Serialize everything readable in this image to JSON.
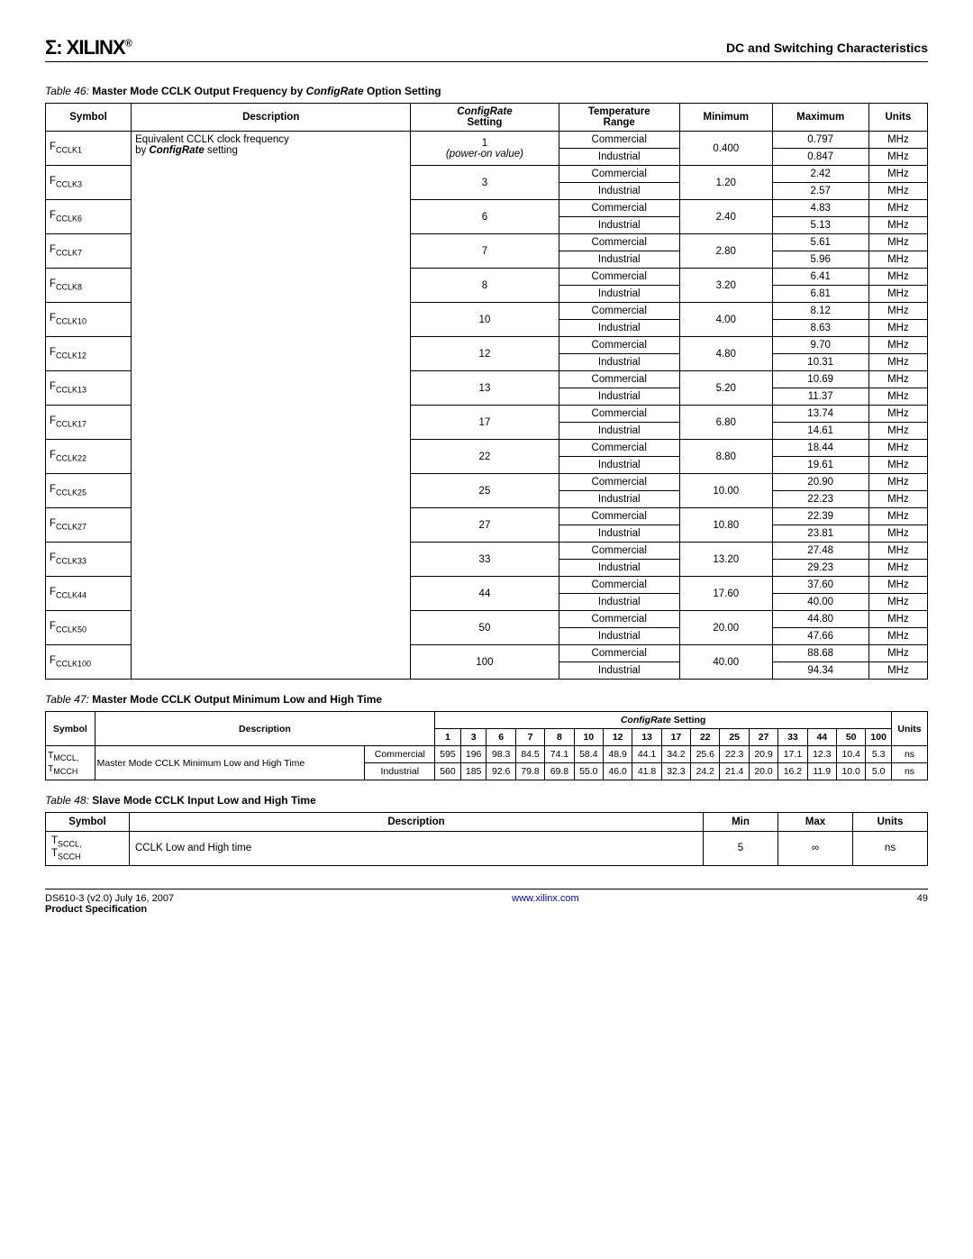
{
  "header": {
    "logo_text": "XILINX",
    "logo_mark": "Σ:",
    "doc_title": "DC and Switching Characteristics"
  },
  "table46": {
    "title_prefix": "Table  46:",
    "title_bold1": "Master Mode CCLK Output Frequency by ",
    "title_ital": "ConfigRate",
    "title_bold2": " Option Setting",
    "headers": {
      "symbol": "Symbol",
      "description": "Description",
      "config_ital": "ConfigRate",
      "config_setting": "Setting",
      "temp": "Temperature",
      "range": "Range",
      "min": "Minimum",
      "max": "Maximum",
      "units": "Units"
    },
    "desc_line1": "Equivalent CCLK clock frequency",
    "desc_line2_pre": "by ",
    "desc_line2_ital": "ConfigRate",
    "desc_line2_post": " setting",
    "power_on": "(power-on value)",
    "temp_comm": "Commercial",
    "temp_ind": "Industrial",
    "units_mhz": "MHz",
    "rows": [
      {
        "sym": "CCLK1",
        "cfg": "1",
        "min": "0.400",
        "max_c": "0.797",
        "max_i": "0.847"
      },
      {
        "sym": "CCLK3",
        "cfg": "3",
        "min": "1.20",
        "max_c": "2.42",
        "max_i": "2.57"
      },
      {
        "sym": "CCLK6",
        "cfg": "6",
        "min": "2.40",
        "max_c": "4.83",
        "max_i": "5.13"
      },
      {
        "sym": "CCLK7",
        "cfg": "7",
        "min": "2.80",
        "max_c": "5.61",
        "max_i": "5.96"
      },
      {
        "sym": "CCLK8",
        "cfg": "8",
        "min": "3.20",
        "max_c": "6.41",
        "max_i": "6.81"
      },
      {
        "sym": "CCLK10",
        "cfg": "10",
        "min": "4.00",
        "max_c": "8.12",
        "max_i": "8.63"
      },
      {
        "sym": "CCLK12",
        "cfg": "12",
        "min": "4.80",
        "max_c": "9.70",
        "max_i": "10.31"
      },
      {
        "sym": "CCLK13",
        "cfg": "13",
        "min": "5.20",
        "max_c": "10.69",
        "max_i": "11.37"
      },
      {
        "sym": "CCLK17",
        "cfg": "17",
        "min": "6.80",
        "max_c": "13.74",
        "max_i": "14.61"
      },
      {
        "sym": "CCLK22",
        "cfg": "22",
        "min": "8.80",
        "max_c": "18.44",
        "max_i": "19.61"
      },
      {
        "sym": "CCLK25",
        "cfg": "25",
        "min": "10.00",
        "max_c": "20.90",
        "max_i": "22.23"
      },
      {
        "sym": "CCLK27",
        "cfg": "27",
        "min": "10.80",
        "max_c": "22.39",
        "max_i": "23.81"
      },
      {
        "sym": "CCLK33",
        "cfg": "33",
        "min": "13.20",
        "max_c": "27.48",
        "max_i": "29.23"
      },
      {
        "sym": "CCLK44",
        "cfg": "44",
        "min": "17.60",
        "max_c": "37.60",
        "max_i": "40.00"
      },
      {
        "sym": "CCLK50",
        "cfg": "50",
        "min": "20.00",
        "max_c": "44.80",
        "max_i": "47.66"
      },
      {
        "sym": "CCLK100",
        "cfg": "100",
        "min": "40.00",
        "max_c": "88.68",
        "max_i": "94.34"
      }
    ]
  },
  "table47": {
    "title_prefix": "Table  47:",
    "title_bold": "Master Mode CCLK Output Minimum Low and High Time",
    "h_symbol": "Symbol",
    "h_desc": "Description",
    "h_cfg_ital": "ConfigRate",
    "h_cfg_setting": " Setting",
    "h_units": "Units",
    "cfg_cols": [
      "1",
      "3",
      "6",
      "7",
      "8",
      "10",
      "12",
      "13",
      "17",
      "22",
      "25",
      "27",
      "33",
      "44",
      "50",
      "100"
    ],
    "sym1": "MCCL,",
    "sym2": "MCCH",
    "desc_block": "Master Mode CCLK Minimum Low and High Time",
    "row_comm_label": "Commercial",
    "row_ind_label": "Industrial",
    "row_comm": [
      "595",
      "196",
      "98.3",
      "84.5",
      "74.1",
      "58.4",
      "48.9",
      "44.1",
      "34.2",
      "25.6",
      "22.3",
      "20.9",
      "17.1",
      "12.3",
      "10.4",
      "5.3"
    ],
    "row_ind": [
      "560",
      "185",
      "92.6",
      "79.8",
      "69.8",
      "55.0",
      "46.0",
      "41.8",
      "32.3",
      "24.2",
      "21.4",
      "20.0",
      "16.2",
      "11.9",
      "10.0",
      "5.0"
    ],
    "units_ns": "ns"
  },
  "table48": {
    "title_prefix": "Table  48:",
    "title_bold": "Slave Mode CCLK Input Low and High Time",
    "h_symbol": "Symbol",
    "h_desc": "Description",
    "h_min": "Min",
    "h_max": "Max",
    "h_units": "Units",
    "sym1": "SCCL,",
    "sym2": "SCCH",
    "desc": "CCLK Low and High time",
    "min": "5",
    "max": "∞",
    "units": "ns"
  },
  "footer": {
    "left1": "DS610-3 (v2.0) July 16, 2007",
    "left2": "Product Specification",
    "center": "www.xilinx.com",
    "right": "49"
  }
}
